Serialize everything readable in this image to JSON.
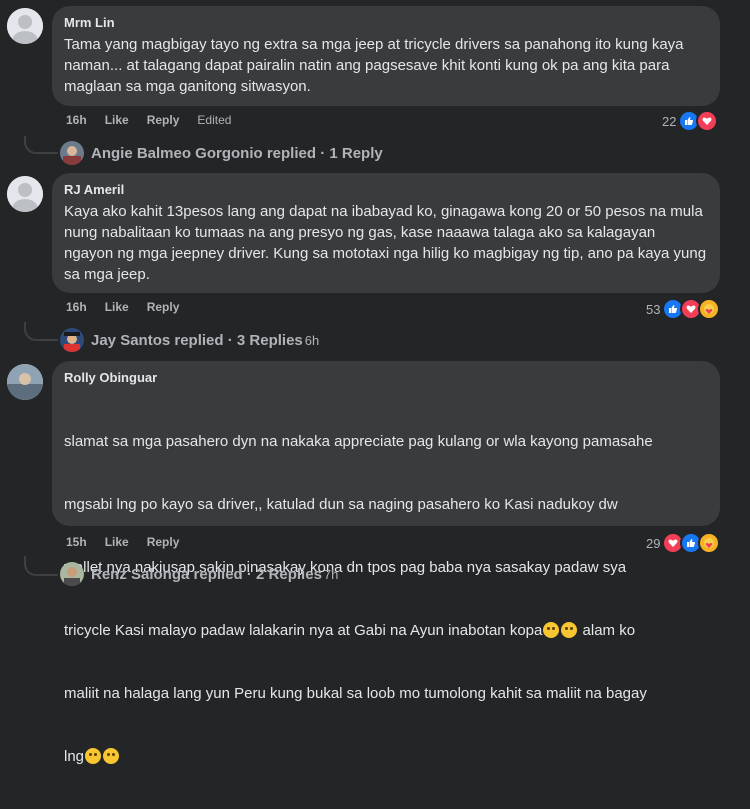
{
  "comments": [
    {
      "author": "Mrm Lin",
      "text": "Tama yang magbigay tayo ng extra sa mga jeep at tricycle drivers sa panahong ito kung kaya naman... at talagang dapat pairalin natin ang pagsesave khit konti kung ok pa ang kita para maglaan sa mga ganitong sitwasyon.",
      "time": "16h",
      "like": "Like",
      "reply": "Reply",
      "edited": "Edited",
      "reaction_count": "22",
      "reactions": [
        "like-icon",
        "love-icon"
      ],
      "reply_summary": {
        "name": "Angie Balmeo Gorgonio replied",
        "sep": " · ",
        "count": "1 Reply",
        "time": ""
      }
    },
    {
      "author": "RJ Ameril",
      "text": "Kaya ako kahit 13pesos lang ang dapat na ibabayad ko, ginagawa kong 20 or 50 pesos na mula nung nabalitaan ko tumaas na ang presyo ng gas, kase naaawa talaga ako sa kalagayan ngayon ng mga jeepney driver. Kung sa mototaxi nga hilig ko magbigay ng tip, ano pa kaya yung sa mga jeep.",
      "time": "16h",
      "like": "Like",
      "reply": "Reply",
      "edited": "",
      "reaction_count": "53",
      "reactions": [
        "like-icon",
        "love-icon",
        "care-icon"
      ],
      "reply_summary": {
        "name": "Jay Santos replied",
        "sep": " · ",
        "count": "3 Replies",
        "time": "6h"
      }
    },
    {
      "author": "Rolly Obinguar",
      "text_lines": [
        "slamat sa mga pasahero dyn na nakaka appreciate pag kulang or wla kayong pamasahe",
        "mgsabi lng po kayo sa driver,, katulad dun sa naging pasahero ko Kasi nadukoy dw",
        "wallet nya nakiusap sakin pinasakay kona dn tpos pag baba nya sasakay padaw sya",
        "tricycle Kasi malayo padaw lalakarin nya at Gabi na Ayun inabotan kopa",
        " alam ko",
        "maliit na halaga lang yun Peru kung bukal sa loob mo tumolong kahit sa maliit na bagay",
        "lng"
      ],
      "time": "15h",
      "like": "Like",
      "reply": "Reply",
      "edited": "",
      "reaction_count": "29",
      "reactions": [
        "love-icon",
        "like-icon",
        "care-icon"
      ],
      "reply_summary": {
        "name": "Renz Salonga replied",
        "sep": " · ",
        "count": "2 Replies",
        "time": "7h"
      }
    }
  ],
  "colors": {
    "bg": "#242526",
    "bubble": "#3a3b3c",
    "text": "#e4e6eb",
    "muted": "#b0b3b8",
    "like": "#1877f2",
    "love": "#f33e58",
    "care": "#f7b125"
  }
}
